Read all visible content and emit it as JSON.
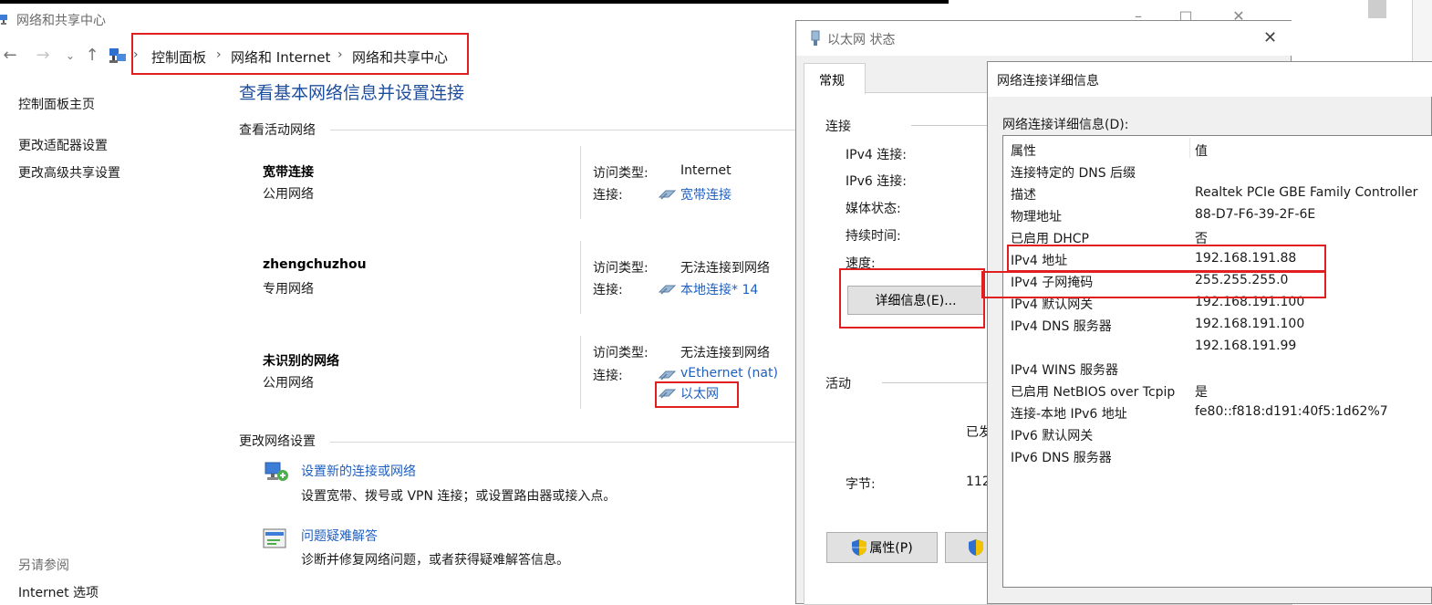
{
  "main_window": {
    "title": "网络和共享中心",
    "breadcrumb": [
      "控制面板",
      "网络和 Internet",
      "网络和共享中心"
    ]
  },
  "sidebar": {
    "links": [
      "控制面板主页",
      "更改适配器设置",
      "更改高级共享设置"
    ],
    "see_also_title": "另请参阅",
    "see_also_links": [
      "Internet 选项"
    ]
  },
  "main": {
    "page_title": "查看基本网络信息并设置连接",
    "active_networks_title": "查看活动网络",
    "access_type_label": "访问类型:",
    "connection_label": "连接:",
    "networks": [
      {
        "name": "宽带连接",
        "type": "公用网络",
        "access": "Internet",
        "connections": [
          "宽带连接"
        ]
      },
      {
        "name": "zhengchuzhou",
        "type": "专用网络",
        "access": "无法连接到网络",
        "connections": [
          "本地连接* 14"
        ]
      },
      {
        "name": "未识别的网络",
        "type": "公用网络",
        "access": "无法连接到网络",
        "connections": [
          "vEthernet (nat)",
          "以太网"
        ]
      }
    ],
    "change_settings_title": "更改网络设置",
    "tasks": [
      {
        "link": "设置新的连接或网络",
        "desc": "设置宽带、拨号或 VPN 连接；或设置路由器或接入点。",
        "icon": "network-setup-icon"
      },
      {
        "link": "问题疑难解答",
        "desc": "诊断并修复网络问题，或者获得疑难解答信息。",
        "icon": "troubleshoot-icon"
      }
    ]
  },
  "status_dialog": {
    "title": "以太网 状态",
    "tab": "常规",
    "connection_group": "连接",
    "fields": [
      "IPv4 连接:",
      "IPv6 连接:",
      "媒体状态:",
      "持续时间:",
      "速度:"
    ],
    "details_button": "详细信息(E)...",
    "activity_group": "活动",
    "activity_partial": "已发",
    "bytes_label": "字节:",
    "bytes_partial": "112",
    "properties_button": "属性(P)"
  },
  "details_dialog": {
    "title": "网络连接详细信息",
    "label": "网络连接详细信息(D):",
    "columns": [
      "属性",
      "值"
    ],
    "rows": [
      {
        "prop": "连接特定的 DNS 后缀",
        "val": ""
      },
      {
        "prop": "描述",
        "val": "Realtek PCIe GBE Family Controller"
      },
      {
        "prop": "物理地址",
        "val": "88-D7-F6-39-2F-6E"
      },
      {
        "prop": "已启用 DHCP",
        "val": "否"
      },
      {
        "prop": "IPv4 地址",
        "val": "192.168.191.88"
      },
      {
        "prop": "IPv4 子网掩码",
        "val": "255.255.255.0"
      },
      {
        "prop": "IPv4 默认网关",
        "val": "192.168.191.100"
      },
      {
        "prop": "IPv4 DNS 服务器",
        "val": "192.168.191.100"
      },
      {
        "prop": "",
        "val": "192.168.191.99"
      },
      {
        "prop": "IPv4 WINS 服务器",
        "val": ""
      },
      {
        "prop": "已启用 NetBIOS over Tcpip",
        "val": "是"
      },
      {
        "prop": "连接-本地 IPv6 地址",
        "val": "fe80::f818:d191:40f5:1d62%7"
      },
      {
        "prop": "IPv6 默认网关",
        "val": ""
      },
      {
        "prop": "IPv6 DNS 服务器",
        "val": ""
      }
    ]
  },
  "colors": {
    "link": "#1f5fbf",
    "page_title": "#1e4e9e",
    "highlight_box": "#e02020"
  }
}
